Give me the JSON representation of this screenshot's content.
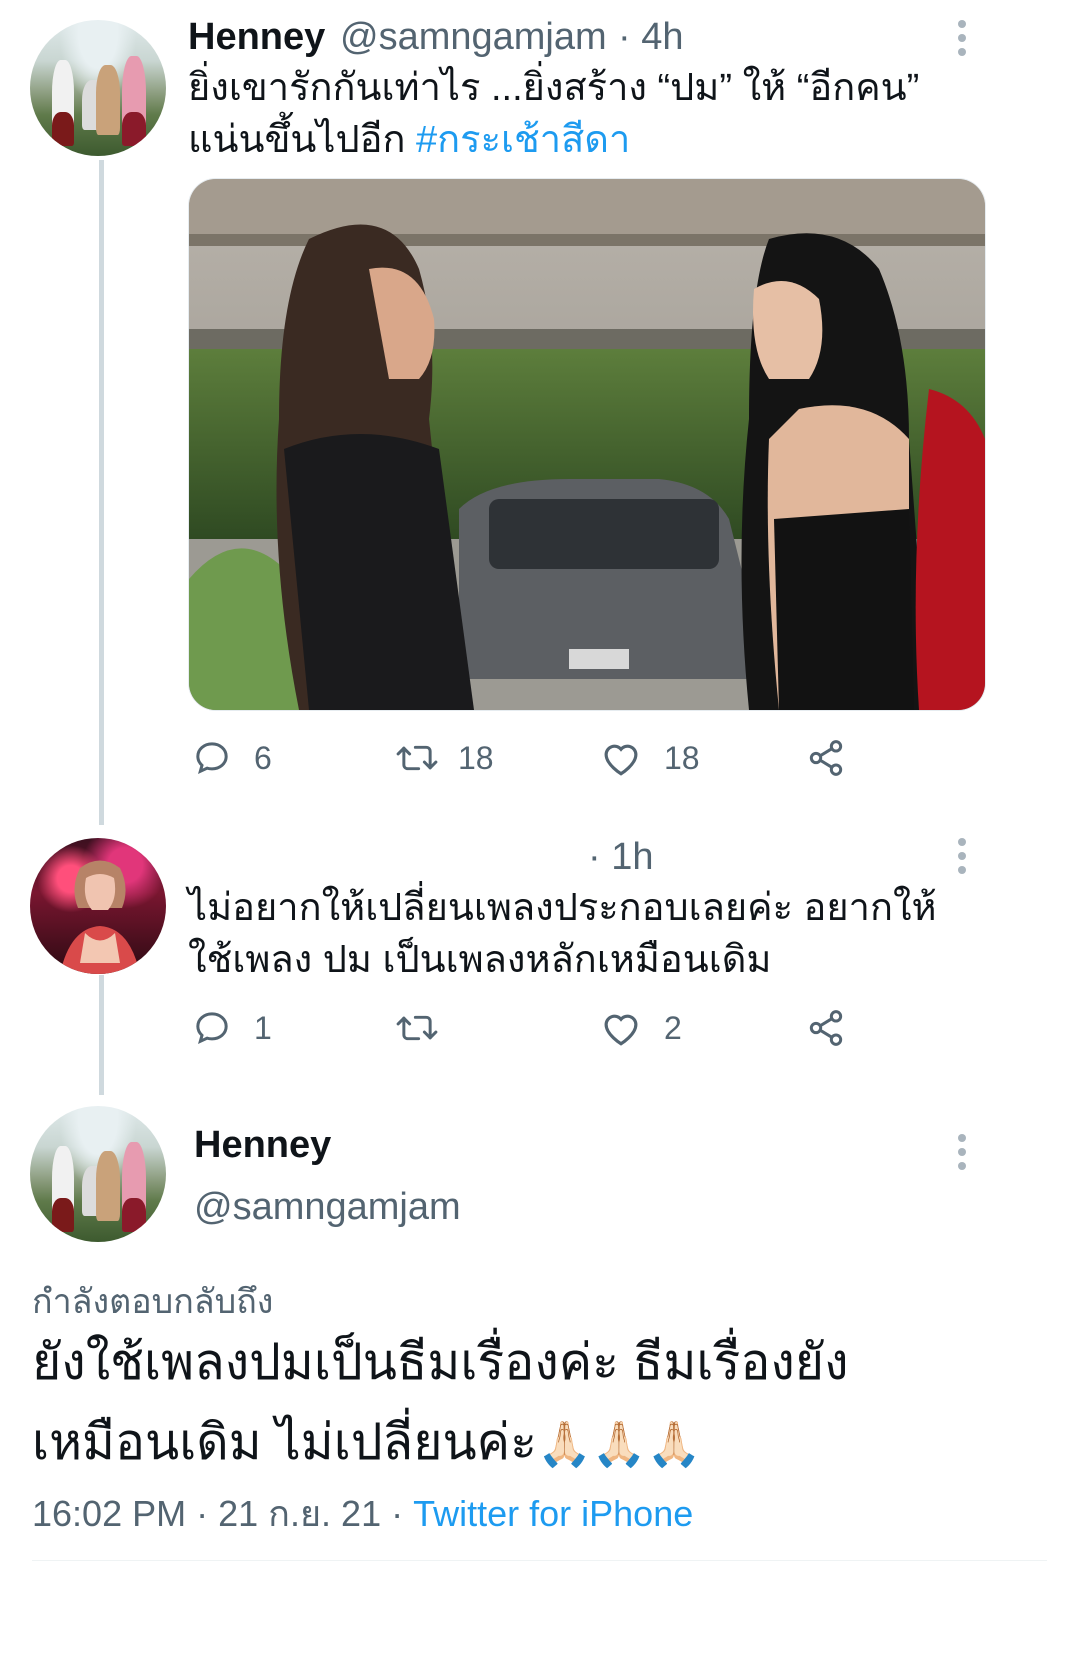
{
  "tweet1": {
    "name": "Henney",
    "handle": "@samngamjam",
    "time": "· 4h",
    "text_line1": "ยิ่งเขารักกันเท่าไร ...ยิ่งสร้าง “ปม” ให้ “อีกคน”",
    "text_line2": "แน่นขึ้นไปอีก ",
    "hashtag": "#กระเช้าสีดา",
    "replies": "6",
    "retweets": "18",
    "likes": "18"
  },
  "tweet2": {
    "time": "· 1h",
    "text_line1": "ไม่อยากให้เปลี่ยนเพลงประกอบเลยค่ะ อยากให้",
    "text_line2": "ใช้เพลง ปม เป็นเพลงหลักเหมือนเดิม",
    "replies": "1",
    "likes": "2"
  },
  "tweet3": {
    "name": "Henney",
    "handle": "@samngamjam",
    "replying_to": "กำลังตอบกลับถึง",
    "text_line1": "ยังใช้เพลงปมเป็นธีมเรื่องค่ะ ธีมเรื่องยัง",
    "text_line2": "เหมือนเดิม ไม่เปลี่ยนค่ะ",
    "emoji": "🙏🏻🙏🏻🙏🏻",
    "time": "16:02 PM",
    "date": "21 ก.ย. 21",
    "source": "Twitter for iPhone"
  },
  "colors": {
    "accent": "#1d9bf0",
    "muted": "#536471",
    "line": "#cfd9de"
  },
  "icons": [
    "reply-icon",
    "retweet-icon",
    "like-icon",
    "share-icon",
    "more-icon"
  ]
}
